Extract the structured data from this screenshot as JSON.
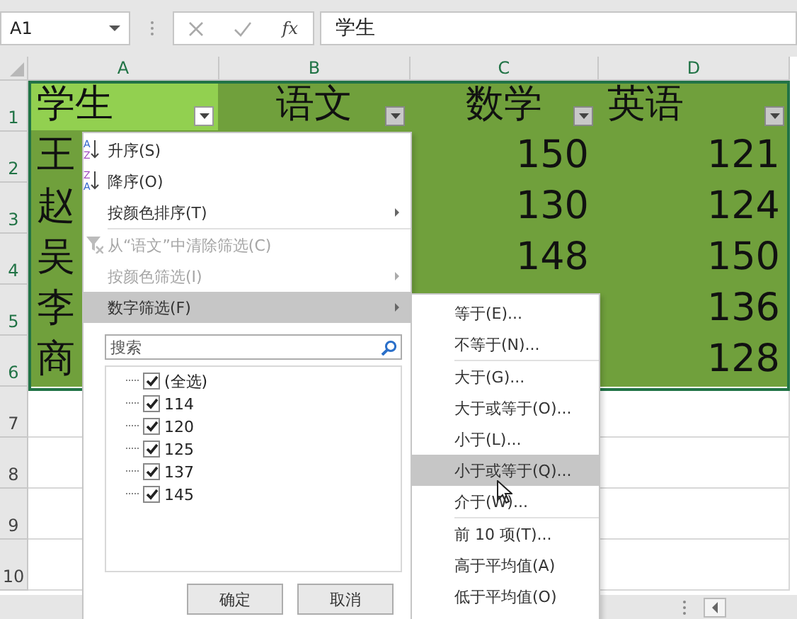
{
  "formula_bar": {
    "name_box": "A1",
    "function_label": "fx",
    "formula": "学生"
  },
  "sheet": {
    "columns": [
      "A",
      "B",
      "C",
      "D"
    ],
    "header_row": {
      "number": "1",
      "cells": [
        {
          "text": "学生",
          "selected": true,
          "filter_open": true
        },
        {
          "text": "语文",
          "selected": false,
          "filter_open": false
        },
        {
          "text": "数学",
          "selected": false,
          "filter_open": false
        },
        {
          "text": "英语",
          "selected": false,
          "filter_open": false
        }
      ]
    },
    "rows": [
      {
        "number": "2",
        "cells": {
          "a": "王",
          "c": "150",
          "d": "121"
        }
      },
      {
        "number": "3",
        "cells": {
          "a": "赵",
          "c": "130",
          "d": "124"
        }
      },
      {
        "number": "4",
        "cells": {
          "a": "吴",
          "c": "148",
          "d": "150"
        }
      },
      {
        "number": "5",
        "cells": {
          "a": "李",
          "d": "136"
        }
      },
      {
        "number": "6",
        "cells": {
          "a": "商",
          "d": "128"
        }
      },
      {
        "number": "7"
      },
      {
        "number": "8"
      },
      {
        "number": "9"
      },
      {
        "number": "10"
      }
    ]
  },
  "filter_menu": {
    "groups": [
      [
        {
          "kind": "ascending",
          "label": "升序(S)",
          "icon_letters": [
            "A",
            "Z"
          ],
          "disabled": false,
          "selected": false
        },
        {
          "kind": "descending",
          "label": "降序(O)",
          "icon_letters": [
            "Z",
            "A"
          ],
          "disabled": false,
          "selected": false
        },
        {
          "kind": "submenu",
          "label": "按颜色排序(T)",
          "disabled": false,
          "selected": false
        }
      ],
      [
        {
          "kind": "clear",
          "label": "从“语文”中清除筛选(C)",
          "disabled": true,
          "selected": false
        },
        {
          "kind": "submenu",
          "label": "按颜色筛选(I)",
          "disabled": true,
          "selected": false
        },
        {
          "kind": "submenu",
          "label": "数字筛选(F)",
          "disabled": false,
          "selected": true
        }
      ]
    ],
    "search": {
      "placeholder": "搜索"
    },
    "values": [
      {
        "label": "(全选)",
        "checked": true
      },
      {
        "label": "114",
        "checked": true
      },
      {
        "label": "120",
        "checked": true
      },
      {
        "label": "125",
        "checked": true
      },
      {
        "label": "137",
        "checked": true
      },
      {
        "label": "145",
        "checked": true
      }
    ],
    "buttons": [
      "确定",
      "取消"
    ]
  },
  "number_filter_menu": {
    "groups": [
      [
        {
          "label": "等于(E)...",
          "selected": false
        },
        {
          "label": "不等于(N)...",
          "selected": false
        }
      ],
      [
        {
          "label": "大于(G)...",
          "selected": false
        },
        {
          "label": "大于或等于(O)...",
          "selected": false
        },
        {
          "label": "小于(L)...",
          "selected": false
        },
        {
          "label": "小于或等于(Q)...",
          "selected": true
        },
        {
          "label": "介于(W)...",
          "selected": false
        }
      ],
      [
        {
          "label": "前 10 项(T)...",
          "selected": false
        },
        {
          "label": "高于平均值(A)",
          "selected": false
        },
        {
          "label": "低于平均值(O)",
          "selected": false
        }
      ]
    ]
  }
}
